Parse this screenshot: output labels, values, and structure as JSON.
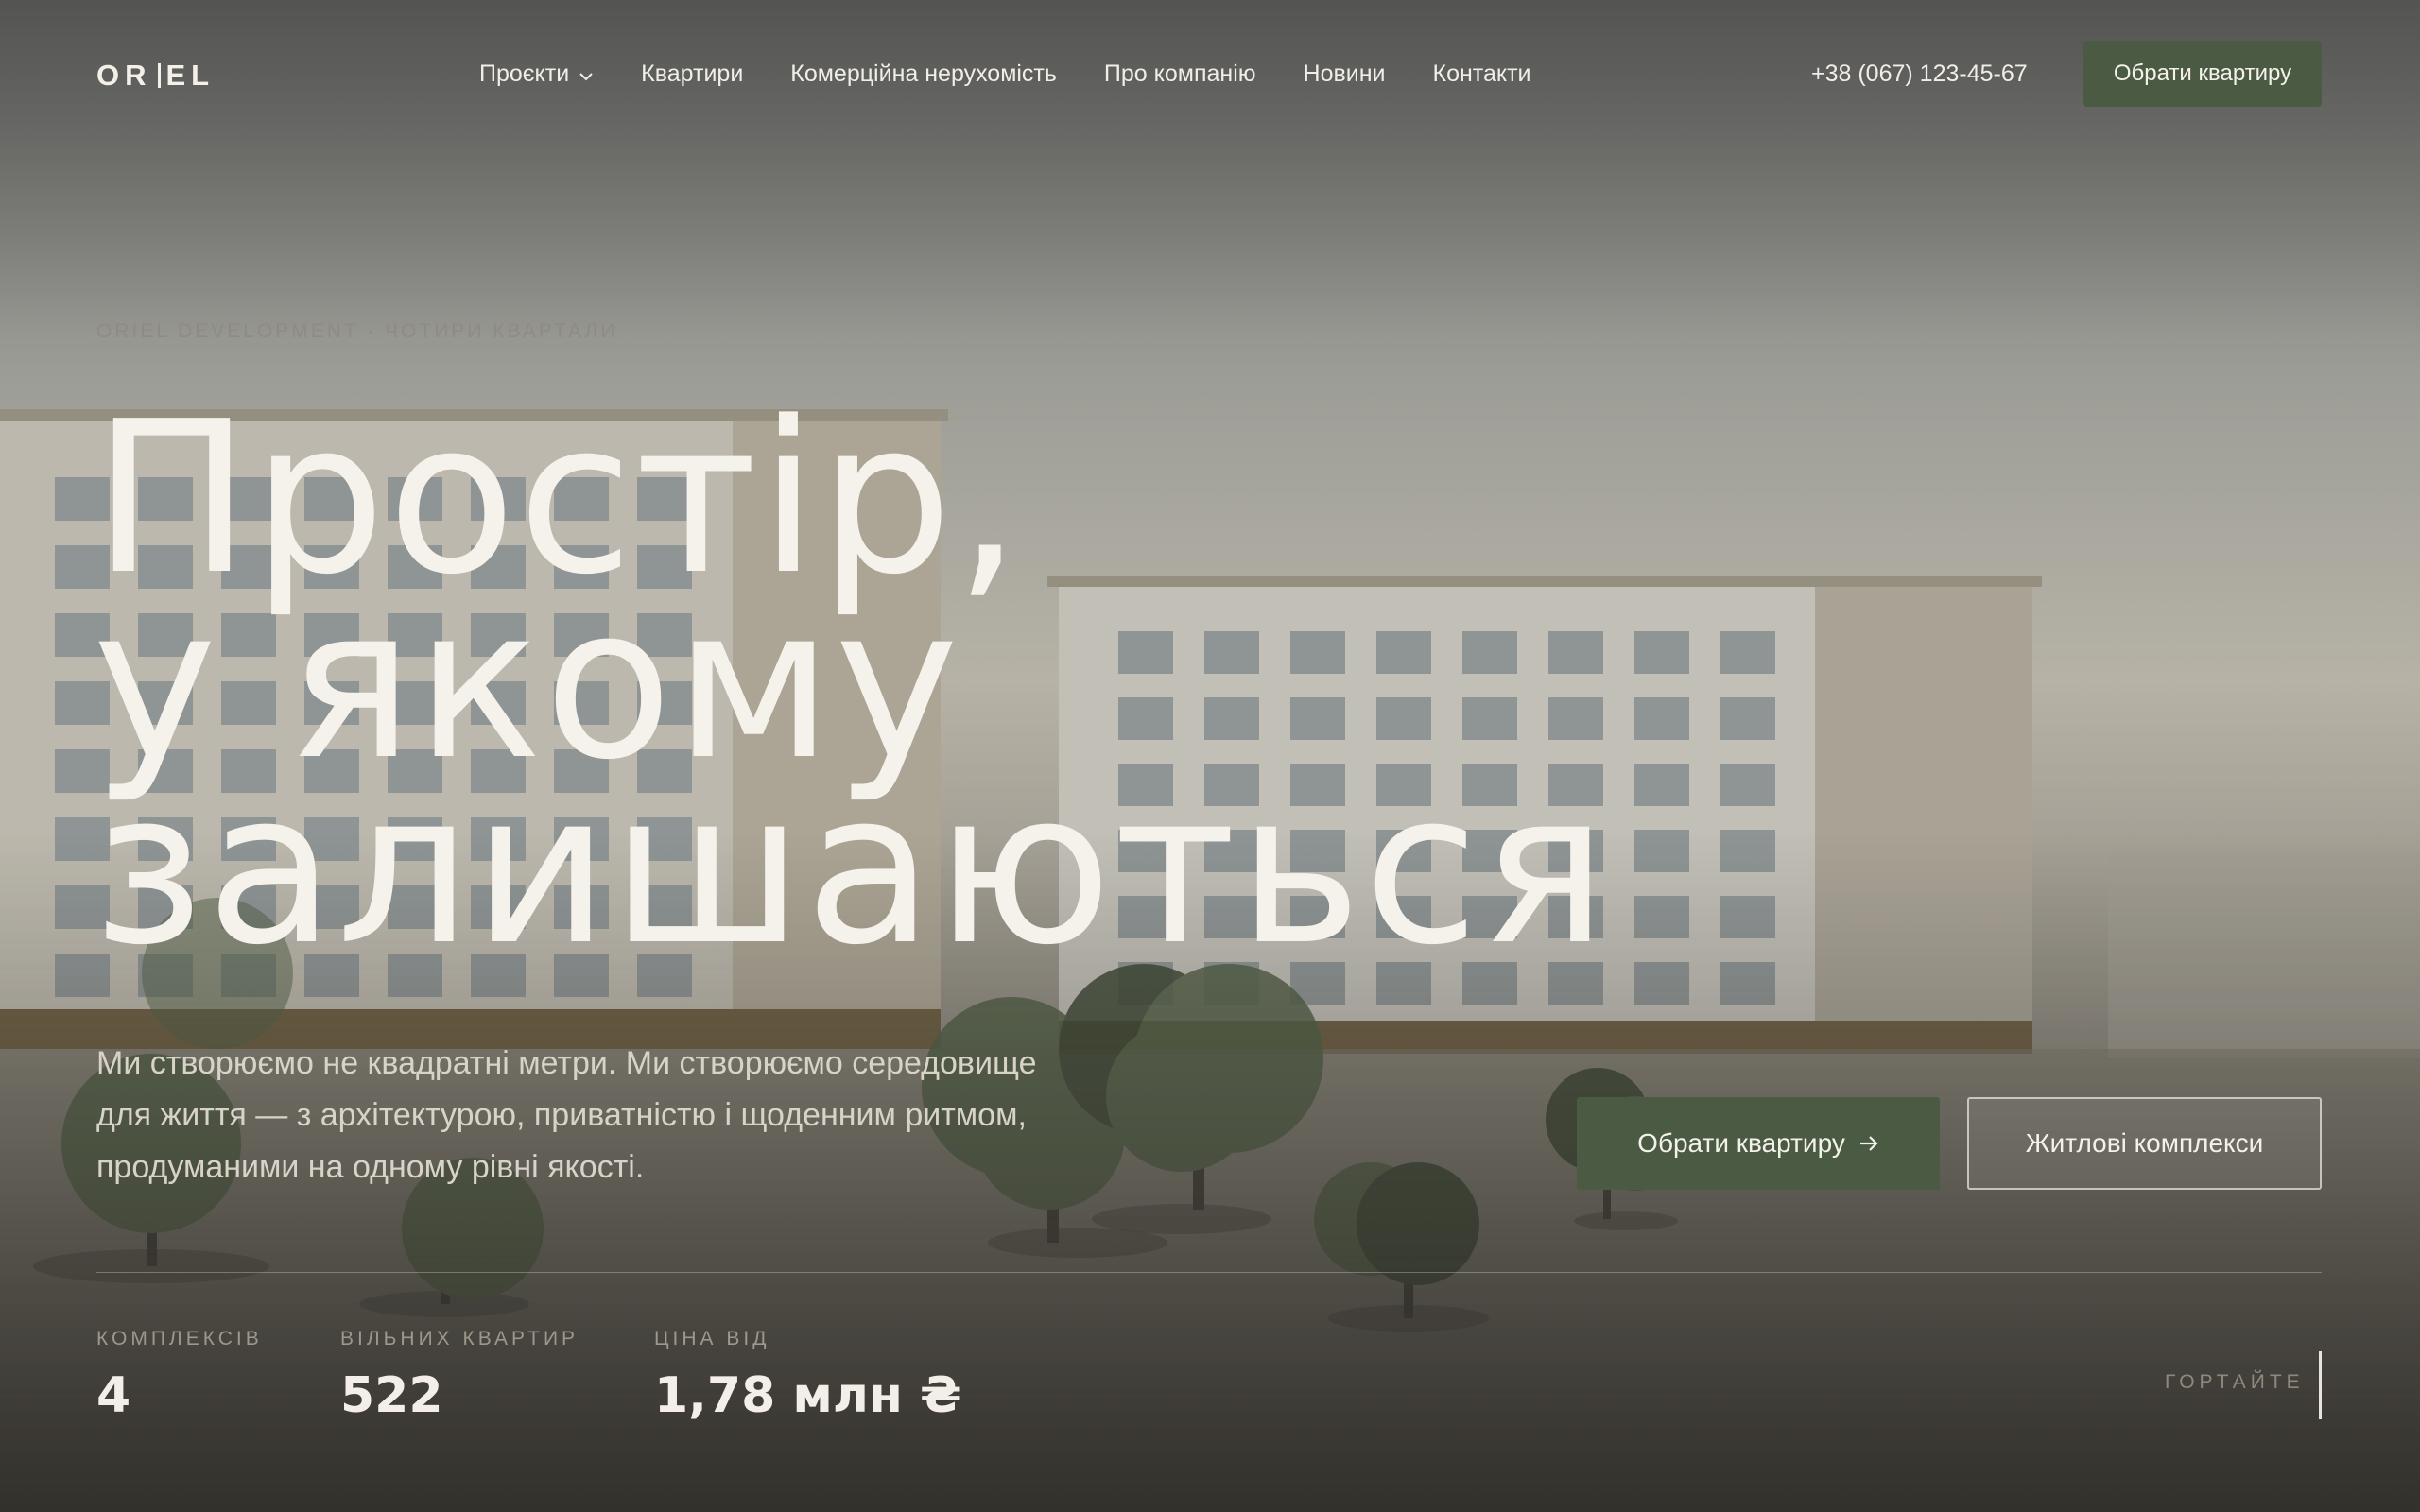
{
  "brand": {
    "logo_left": "OR",
    "logo_right": "EL"
  },
  "nav": {
    "items": [
      {
        "label": "Проєкти",
        "has_dropdown": true
      },
      {
        "label": "Квартири"
      },
      {
        "label": "Комерційна нерухомість"
      },
      {
        "label": "Про компанію"
      },
      {
        "label": "Новини"
      },
      {
        "label": "Контакти"
      }
    ]
  },
  "header": {
    "phone": "+38 (067) 123-45-67",
    "cta": "Обрати квартиру"
  },
  "hero": {
    "eyebrow": "ORIEL DEVELOPMENT · ЧОТИРИ КВАРТАЛИ",
    "headline_lines": [
      "Простір,",
      "у якому",
      "залишаються"
    ],
    "lead": "Ми створюємо не квадратні метри. Ми створюємо середовище для життя — з архітектурою, приватністю і щоденним ритмом, продуманими на одному рівні якості.",
    "primary_cta": "Обрати квартиру",
    "secondary_cta": "Житлові комплекси"
  },
  "stats": [
    {
      "label": "КОМПЛЕКСІВ",
      "value": "4"
    },
    {
      "label": "ВІЛЬНИХ КВАРТИР",
      "value": "522"
    },
    {
      "label": "ЦІНА ВІД",
      "value": "1,78 млн ₴"
    }
  ],
  "scroll": {
    "label": "ГОРТАЙТЕ"
  },
  "colors": {
    "accent": "#4b5a43",
    "text_light": "#f5f2ec",
    "muted": "#8f8b80"
  },
  "icons": {
    "dropdown": "chevron-down-icon",
    "arrow": "arrow-right-icon"
  }
}
